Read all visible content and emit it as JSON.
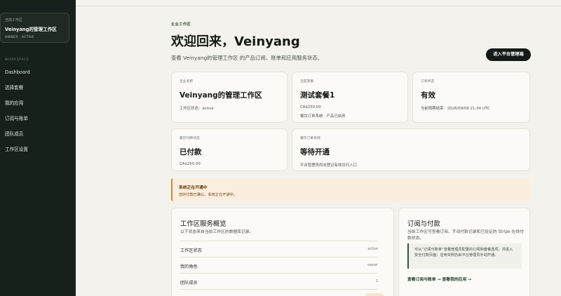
{
  "sidebar": {
    "workspace_label": "当前工作区",
    "workspace_name": "Veinyang的管理工作区",
    "workspace_meta": "OWNER · ACTIVE",
    "section_label": "WORKSPACE",
    "items": [
      {
        "label": "Dashboard"
      },
      {
        "label": "选择套餐"
      },
      {
        "label": "我的应用"
      },
      {
        "label": "订阅与账单"
      },
      {
        "label": "团队成员"
      },
      {
        "label": "工作区设置"
      }
    ]
  },
  "header": {
    "eyebrow": "企业工作区",
    "title": "欢迎回来，Veinyang",
    "subtitle": "查看 Veinyang的管理工作区 的产品订阅、账单和应用服务状态。",
    "admin_button": "进入平台管理端"
  },
  "cards": [
    {
      "label": "企业名称",
      "value": "Veinyang的管理工作区",
      "sub": "工作区状态：active"
    },
    {
      "label": "当前套餐",
      "value": "测试套餐1",
      "sub": "CA$250.00",
      "sub2": "餐饮订单系统 · 产品已启用"
    },
    {
      "label": "订阅状态",
      "value": "有效",
      "sub": "当前周期结束：2026/09/08 21:34 UTC"
    },
    {
      "label": "最近付款状态",
      "value": "已付款",
      "sub": "CA$250.00"
    },
    {
      "label": "餐饮订单系统",
      "value": "等待开通",
      "sub": "平台管理员尚未登记有效访问入口"
    }
  ],
  "alert": {
    "title": "系统正在开通中",
    "desc": "您的付款已确认，系统正在开通中。"
  },
  "overview": {
    "title": "工作区服务概览",
    "sub": "以下状态来自当前工作区的数据库记录。",
    "rows": [
      {
        "key": "工作区状态",
        "value": "active"
      },
      {
        "key": "我的角色",
        "value": "owner"
      },
      {
        "key": "团队成员",
        "value": "1"
      }
    ]
  },
  "billing": {
    "title": "订阅与付款",
    "sub": "当前工作区可查看订阅、手动付款记录和已验证的 Stripe 在线付款状态。",
    "note": "可从“订阅与账单”查看管理员配置的订阅和套餐选项，并进入安全付款页面；应用实例仍由平台管理员手动开通。",
    "link": "查看订阅与账单 → 查看我的应用 →"
  }
}
